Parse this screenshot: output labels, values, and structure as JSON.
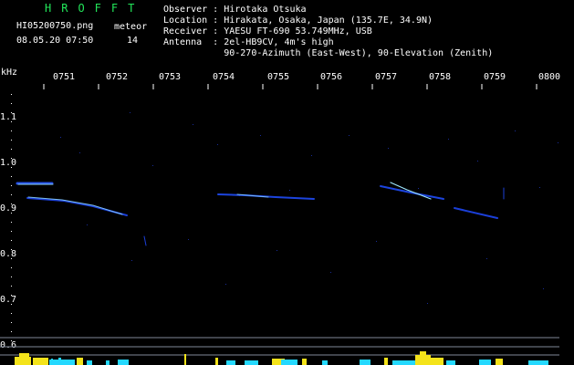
{
  "header": {
    "title": "HROFFT",
    "filename": "HI05200750.png",
    "datetime": "08.05.20 07:50",
    "meteor_label": "meteor",
    "meteor_count": "14",
    "info_lines": [
      "Observer : Hirotaka Otsuka",
      "Location : Hirakata, Osaka, Japan (135.7E, 34.9N)",
      "Receiver : YAESU FT-690 53.749MHz, USB",
      "Antenna  : 2el-HB9CV, 4m's high",
      "           90-270-Azimuth (East-West), 90-Elevation (Zenith)"
    ]
  },
  "axis": {
    "unit": "kHz",
    "time_ticks": [
      "0751",
      "0752",
      "0753",
      "0754",
      "0755",
      "0756",
      "0757",
      "0758",
      "0759",
      "0800"
    ],
    "freq_ticks": [
      "1.1",
      "1.0",
      "0.9",
      "0.8",
      "0.7",
      "0.6"
    ]
  },
  "colors": {
    "background": "#000000",
    "title": "#22e65a",
    "text": "#ffffff",
    "trace_dark": "#1b3fd8",
    "trace_light": "#8fd8ff",
    "spectrum_yellow": "#f4e31a",
    "spectrum_cyan": "#24d8ff",
    "ref_line": "#7f8799"
  }
}
